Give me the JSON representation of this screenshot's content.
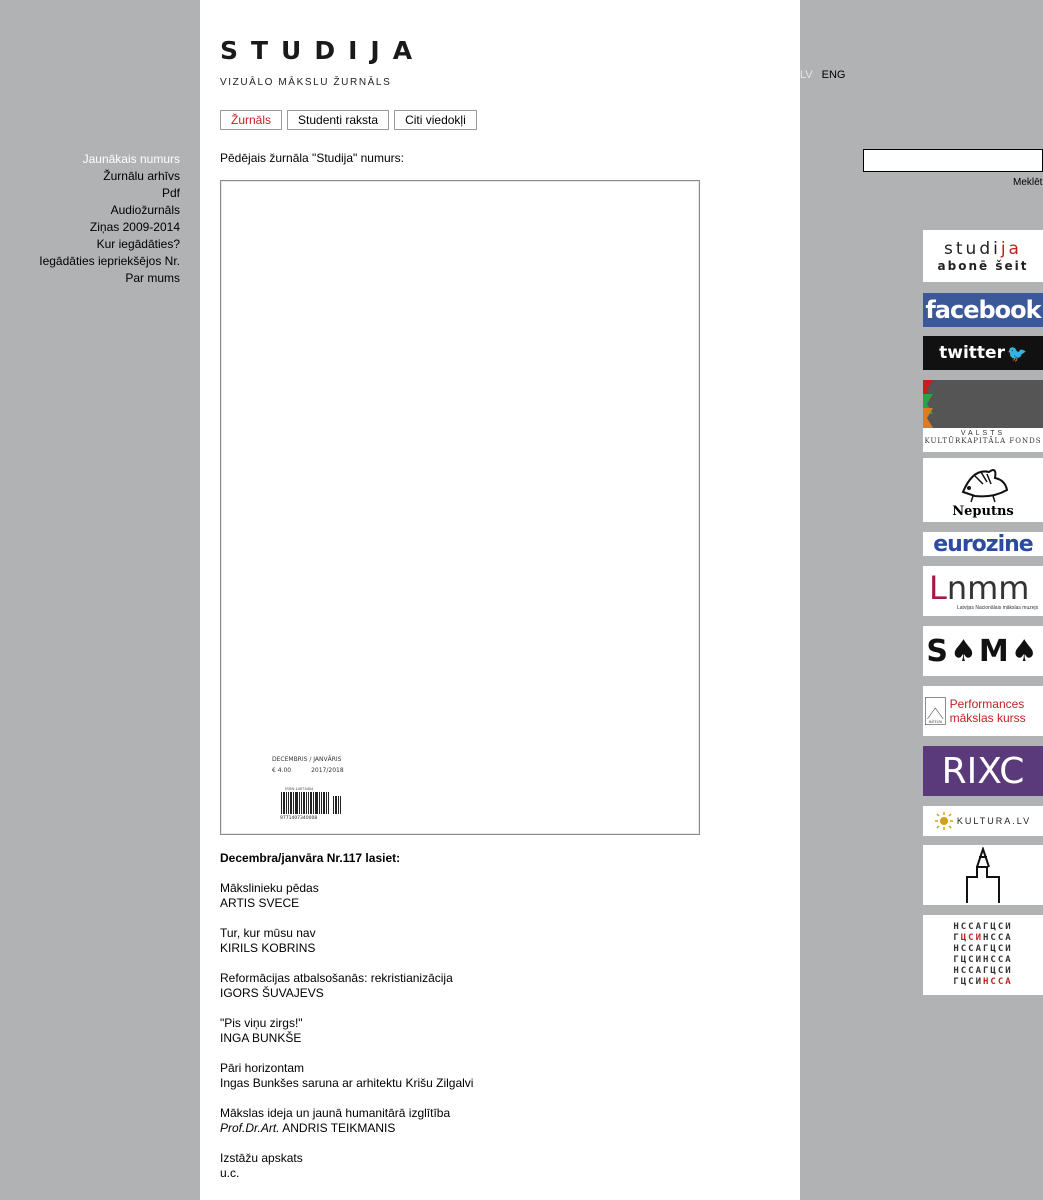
{
  "header": {
    "logo": "STUDIJA",
    "tagline": "VIZUĀLO MĀKSLU ŽURNĀLS"
  },
  "tabs": [
    {
      "label": "Žurnāls",
      "active": true
    },
    {
      "label": "Studenti raksta",
      "active": false
    },
    {
      "label": "Citi viedokļi",
      "active": false
    }
  ],
  "left_nav": [
    {
      "label": "Jaunākais numurs",
      "current": true
    },
    {
      "label": "Žurnālu arhīvs"
    },
    {
      "label": "Pdf"
    },
    {
      "label": "Audiožurnāls"
    },
    {
      "label": "Ziņas 2009-2014"
    },
    {
      "label": "Kur iegādāties?"
    },
    {
      "label": "Iegādāties iepriekšējos Nr."
    },
    {
      "label": "Par mums"
    }
  ],
  "intro": "Pēdējais žurnāla \"Studija\" numurs:",
  "cover": {
    "month": "DECEMBRIS / JANVĀRIS",
    "price": "€ 4.00",
    "year": "2017/2018",
    "issn": "ISSN 14073404",
    "barcode_number": "9771407340008"
  },
  "issue": {
    "lead": "Decembra/janvāra Nr.117 lasiet:",
    "items": [
      {
        "title": "Mākslinieku pēdas",
        "author": "ARTIS SVECE"
      },
      {
        "title": "Tur, kur mūsu nav",
        "author": "KIRILS KOBRINS"
      },
      {
        "title": "Reformācijas atbalsošanās: rekristianizācija",
        "author": "IGORS ŠUVAJEVS"
      },
      {
        "title": "\"Pis viņu zirgs!\"",
        "author": "INGA BUNKŠE"
      },
      {
        "title": "Pāri horizontam",
        "author": "Ingas Bunkšes saruna ar arhitektu Krišu Zilgalvi"
      },
      {
        "title": "Mākslas ideja un jaunā humanitārā izglītība",
        "author_prefix": "Prof.Dr.Art.",
        "author": "ANDRIS TEIKMANIS"
      },
      {
        "title": "Izstāžu apskats",
        "author": "u.c."
      }
    ]
  },
  "language": {
    "lv": "LV",
    "eng": "ENG"
  },
  "search": {
    "button": "Meklēt",
    "value": ""
  },
  "banners": {
    "studija_line1_a": "studi",
    "studija_line1_b": "ja",
    "studija_line2": "abonē šeit",
    "facebook": "facebook",
    "twitter": "twitter",
    "vkkf_line1": "VALSTS",
    "vkkf_line2": "KULTŪRKAPITĀLA FONDS",
    "neputns": "Neputns",
    "eurozine": "eurozine",
    "lnmm": "nmm",
    "lnmm_l": "L",
    "lnmm_small": "Latvijas Nacionālais mākslas muzejs",
    "sama": "S♠M♠",
    "mtelpa_logo": "MĀTELPA",
    "mtelpa_text": "Performances mākslas kurss",
    "rixc": "RIXC",
    "kultura": "KULTURA.LV",
    "letters": [
      {
        "a": "НССАГ",
        "r": "",
        "b": "ЦСИ"
      },
      {
        "a": "Г",
        "r": "ЦСИ",
        "b": "НССА"
      },
      {
        "a": "НССАГЦСИ",
        "r": "",
        "b": ""
      },
      {
        "a": "ГЦСИНССА",
        "r": "",
        "b": ""
      },
      {
        "a": "НССАГЦСИ",
        "r": "",
        "b": ""
      },
      {
        "a": "ГЦСИ",
        "r": "НССА",
        "b": ""
      }
    ]
  }
}
